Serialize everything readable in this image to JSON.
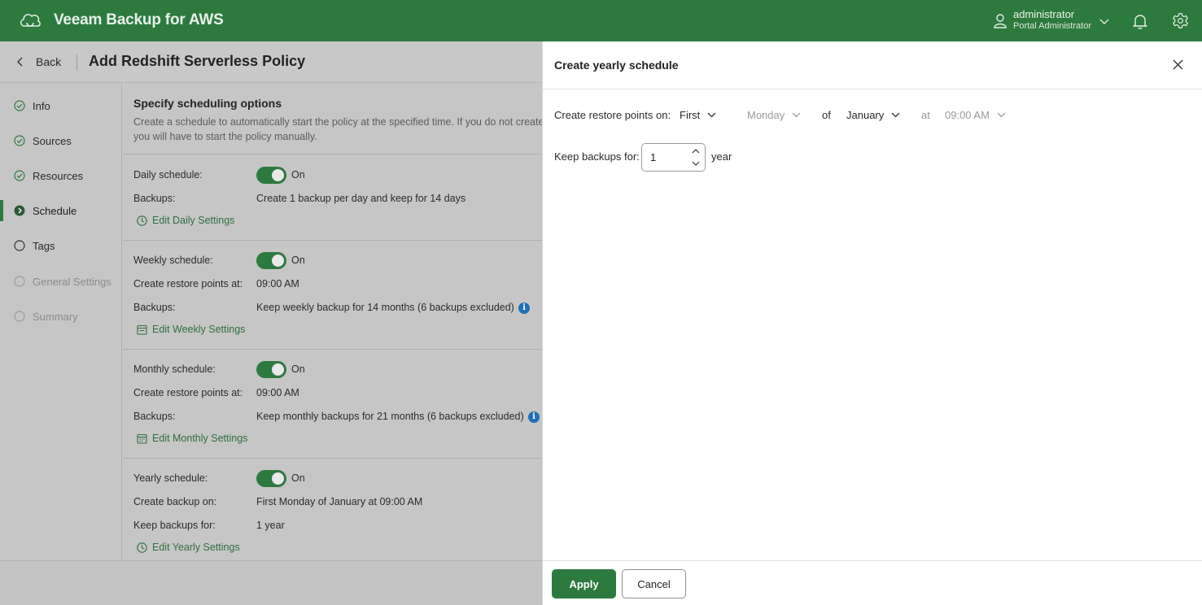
{
  "app": {
    "title": "Veeam Backup for AWS"
  },
  "user": {
    "name": "administrator",
    "role": "Portal Administrator"
  },
  "page": {
    "back_label": "Back",
    "title": "Add Redshift Serverless Policy"
  },
  "steps": [
    {
      "label": "Info",
      "state": "done"
    },
    {
      "label": "Sources",
      "state": "done"
    },
    {
      "label": "Resources",
      "state": "done"
    },
    {
      "label": "Schedule",
      "state": "active"
    },
    {
      "label": "Tags",
      "state": "pending"
    },
    {
      "label": "General Settings",
      "state": "disabled"
    },
    {
      "label": "Summary",
      "state": "disabled"
    }
  ],
  "section": {
    "title": "Specify scheduling options",
    "desc_line1": "Create a schedule to automatically start the policy at the specified time. If you do not create",
    "desc_line2": "you will have to start the policy manually."
  },
  "daily": {
    "schedule_label": "Daily schedule:",
    "toggle_label": "On",
    "backups_label": "Backups:",
    "backups_value": "Create 1 backup per day and keep for 14 days",
    "edit_link": "Edit Daily Settings"
  },
  "weekly": {
    "schedule_label": "Weekly schedule:",
    "toggle_label": "On",
    "restore_label": "Create restore points at:",
    "restore_value": "09:00 AM",
    "backups_label": "Backups:",
    "backups_value": "Keep weekly backup for 14 months (6 backups excluded)",
    "edit_link": "Edit Weekly Settings"
  },
  "monthly": {
    "schedule_label": "Monthly schedule:",
    "toggle_label": "On",
    "restore_label": "Create restore points at:",
    "restore_value": "09:00 AM",
    "backups_label": "Backups:",
    "backups_value": "Keep monthly backups for 21 months (6 backups excluded)",
    "edit_link": "Edit Monthly Settings"
  },
  "yearly": {
    "schedule_label": "Yearly schedule:",
    "toggle_label": "On",
    "create_label": "Create backup on:",
    "create_value": "First Monday of January at 09:00 AM",
    "keep_label": "Keep backups for:",
    "keep_value": "1 year",
    "edit_link": "Edit Yearly Settings"
  },
  "panel": {
    "title": "Create yearly schedule",
    "restore_label": "Create restore points on:",
    "week_value": "First",
    "day_value": "Monday",
    "of_label": "of",
    "month_value": "January",
    "at_label": "at",
    "time_value": "09:00 AM",
    "keep_label": "Keep backups for:",
    "keep_value": "1",
    "keep_unit": "year",
    "apply_label": "Apply",
    "cancel_label": "Cancel"
  },
  "colors": {
    "brand": "#2d7a3f",
    "info": "#1f70b8"
  }
}
